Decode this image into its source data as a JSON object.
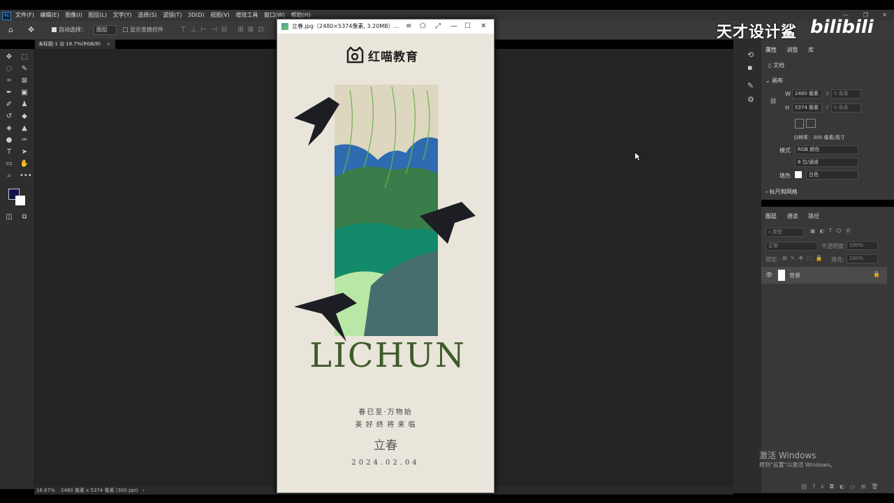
{
  "app": {
    "logo": "Ps",
    "menu": [
      "文件(F)",
      "编辑(E)",
      "图像(I)",
      "图层(L)",
      "文字(Y)",
      "选择(S)",
      "滤镜(T)",
      "3D(D)",
      "视图(V)",
      "增效工具",
      "窗口(W)",
      "帮助(H)"
    ]
  },
  "options": {
    "auto_select_label": "自动选择：",
    "auto_select_value": "图层",
    "transform_label": "显示变换控件"
  },
  "document_tab": {
    "label": "未标题-1 @ 16.7%(RGB/8)",
    "close": "×"
  },
  "status": {
    "zoom": "16.67%",
    "info": "2480 像素 x 5374 像素 (300 ppi)",
    "arrow": "›"
  },
  "viewer": {
    "title": "立春.jpg（2480×5374像素, 3.20MB）...",
    "menu_glyph": "≡",
    "pin_glyph": "⬠",
    "fullscreen_glyph": "⤢",
    "min_glyph": "—",
    "max_glyph": "☐",
    "close_glyph": "✕"
  },
  "poster": {
    "brand": "红喵教育",
    "headline": "LICHUN",
    "line1": "春已至·万物始",
    "line2": "美 好 终 将 来 临",
    "line3": "立春",
    "date": "2024.02.04"
  },
  "watermark": {
    "text": "天才设计鲨",
    "bili": "bilibili"
  },
  "properties": {
    "tabs": [
      "属性",
      "调整",
      "库"
    ],
    "doc_label": "文档",
    "canvas_label": "画布",
    "w_label": "W",
    "w_value": "2480 像素",
    "h_label": "H",
    "h_value": "5374 像素",
    "x_label": "X",
    "x_value": "0 像素",
    "y_label": "Y",
    "y_value": "0 像素",
    "resolution": "分辨率：300 像素/英寸",
    "mode_label": "模式",
    "mode_value": "RGB 颜色",
    "depth_value": "8 位/通道",
    "fill_label": "填色",
    "fill_value": "白色",
    "rulers_label": "标尺和网格"
  },
  "layers": {
    "tabs": [
      "图层",
      "通道",
      "路径"
    ],
    "filter_placeholder": "类型",
    "blend_mode": "正常",
    "opacity_label": "不透明度:",
    "opacity_value": "100%",
    "lock_label": "锁定:",
    "fill_label": "填充:",
    "fill_value": "100%",
    "layer_name": "背景"
  },
  "activation": {
    "line1": "激活 Windows",
    "line2": "转到\"设置\"以激活 Windows。"
  }
}
